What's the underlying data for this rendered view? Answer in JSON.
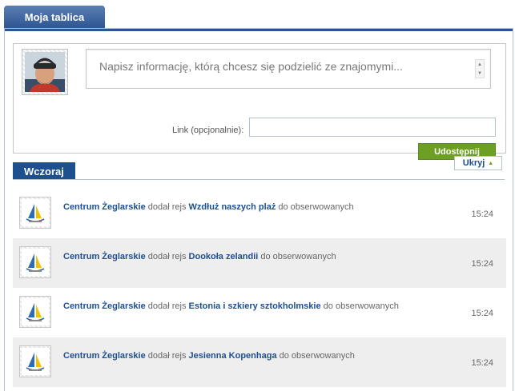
{
  "tab": {
    "title": "Moja tablica"
  },
  "composer": {
    "placeholder": "Napisz informację, którą chcesz się podzielić ze znajomymi...",
    "link_label": "Link (opcjonalnie):",
    "link_value": "",
    "share_label": "Udostępnij"
  },
  "section": {
    "day": "Wczoraj",
    "hide_label": "Ukryj"
  },
  "feed": [
    {
      "actor": "Centrum Żeglarskie",
      "action": "dodał rejs",
      "target": "Wzdłuż naszych plaż",
      "suffix": "do obserwowanych",
      "time": "15:24"
    },
    {
      "actor": "Centrum Żeglarskie",
      "action": "dodał rejs",
      "target": "Dookoła zelandii",
      "suffix": "do obserwowanych",
      "time": "15:24"
    },
    {
      "actor": "Centrum Żeglarskie",
      "action": "dodał rejs",
      "target": "Estonia i szkiery sztokholmskie",
      "suffix": "do obserwowanych",
      "time": "15:24"
    },
    {
      "actor": "Centrum Żeglarskie",
      "action": "dodał rejs",
      "target": "Jesienna Kopenhaga",
      "suffix": "do obserwowanych",
      "time": "15:24"
    }
  ],
  "colors": {
    "accent": "#1e4f8f",
    "share": "#6e9f25"
  }
}
